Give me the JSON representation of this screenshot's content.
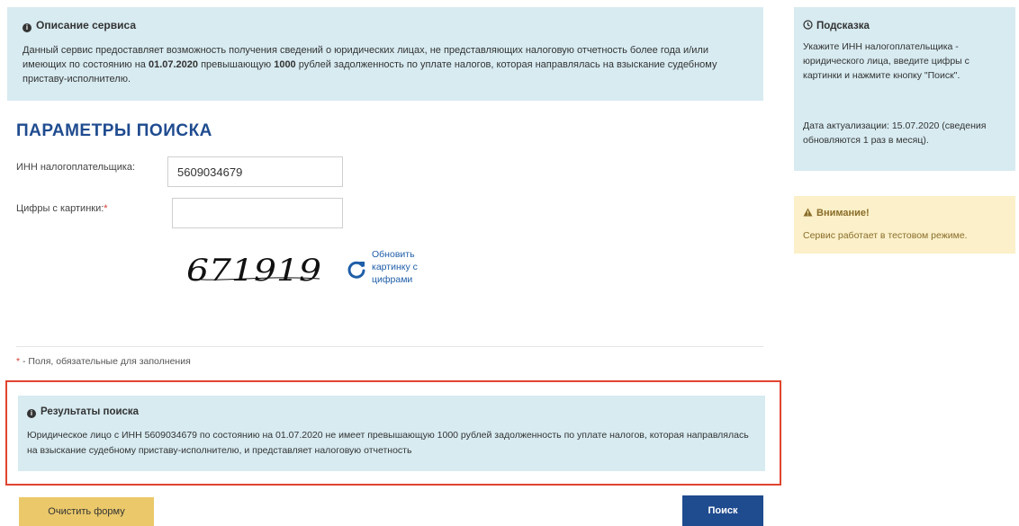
{
  "service_description": {
    "title": "Описание сервиса",
    "text_part1": "Данный сервис предоставляет возможность получения сведений о юридических лицах, не представляющих налоговую отчетность более года и/или имеющих по состоянию на ",
    "date_bold": "01.07.2020",
    "text_part2": " превышающую ",
    "amount_bold": "1000",
    "text_part3": " рублей задолженность по уплате налогов, которая направлялась на взыскание судебному приставу-исполнителю."
  },
  "search_params": {
    "title": "ПАРАМЕТРЫ ПОИСКА",
    "inn_label": "ИНН налогоплательщика:",
    "inn_value": "5609034679",
    "captcha_label": "Цифры с картинки:",
    "captcha_required_mark": "*",
    "captcha_value": "",
    "captcha_image_text": "671919",
    "refresh_label": "Обновить картинку с цифрами"
  },
  "required_note": {
    "mark": "*",
    "text": " - Поля, обязательные для заполнения"
  },
  "results": {
    "title": "Результаты поиска",
    "text": "Юридическое лицо с ИНН 5609034679 по состоянию на 01.07.2020 не имеет превышающую 1000 рублей задолженность по уплате налогов, которая направлялась на взыскание судебному приставу-исполнителю, и представляет налоговую отчетность"
  },
  "buttons": {
    "clear": "Очистить форму",
    "search": "Поиск"
  },
  "hint": {
    "title": "Подсказка",
    "text": "Укажите ИНН налогоплательщика - юридического лица, введите цифры с картинки и нажмите кнопку \"Поиск\".",
    "update_text": "Дата актуализации: 15.07.2020 (сведения обновляются 1 раз в месяц)."
  },
  "warning": {
    "title": "Внимание!",
    "text": "Сервис работает в тестовом режиме."
  },
  "colors": {
    "info_bg": "#d7ebf1",
    "warning_bg": "#fbf0c9",
    "primary": "#1f4b8f",
    "clear_button": "#ebc96a",
    "highlight_border": "#e0442f"
  }
}
